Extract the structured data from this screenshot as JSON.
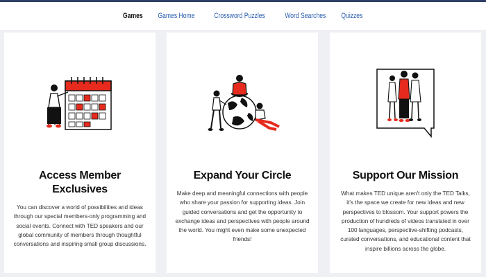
{
  "nav": {
    "items": [
      {
        "label": "Games",
        "active": true
      },
      {
        "label": "Games Home"
      },
      {
        "label": "Crossword Puzzles"
      },
      {
        "label": "Word Searches"
      },
      {
        "label": "Quizzes"
      }
    ]
  },
  "cards": [
    {
      "icon": "calendar-person-illustration",
      "title": "Access Member Exclusives",
      "body": "You can discover a world of possibilities and ideas through our special members-only programming and social events. Connect with TED speakers and our global community of members through thoughtful conversations and inspiring small group discussions."
    },
    {
      "icon": "people-globe-illustration",
      "title": "Expand Your Circle",
      "body": "Make deep and meaningful connections with people who share your passion for supporting ideas. Join guided conversations and get the opportunity to exchange ideas and perspectives with people around the world. You might even make some unexpected friends!"
    },
    {
      "icon": "group-speech-bubble-illustration",
      "title": "Support Our Mission",
      "body": "What makes TED unique aren't only the TED Talks, it's the space we create for new ideas and new perspectives to blossom. Your support powers the production of hundreds of videos translated in over 100 languages, perspective-shifting podcasts, curated conversations, and educational content that inspire billions across the globe."
    }
  ],
  "colors": {
    "accent": "#e62b1e",
    "link": "#2a5fb0",
    "background": "#eef0f3"
  }
}
